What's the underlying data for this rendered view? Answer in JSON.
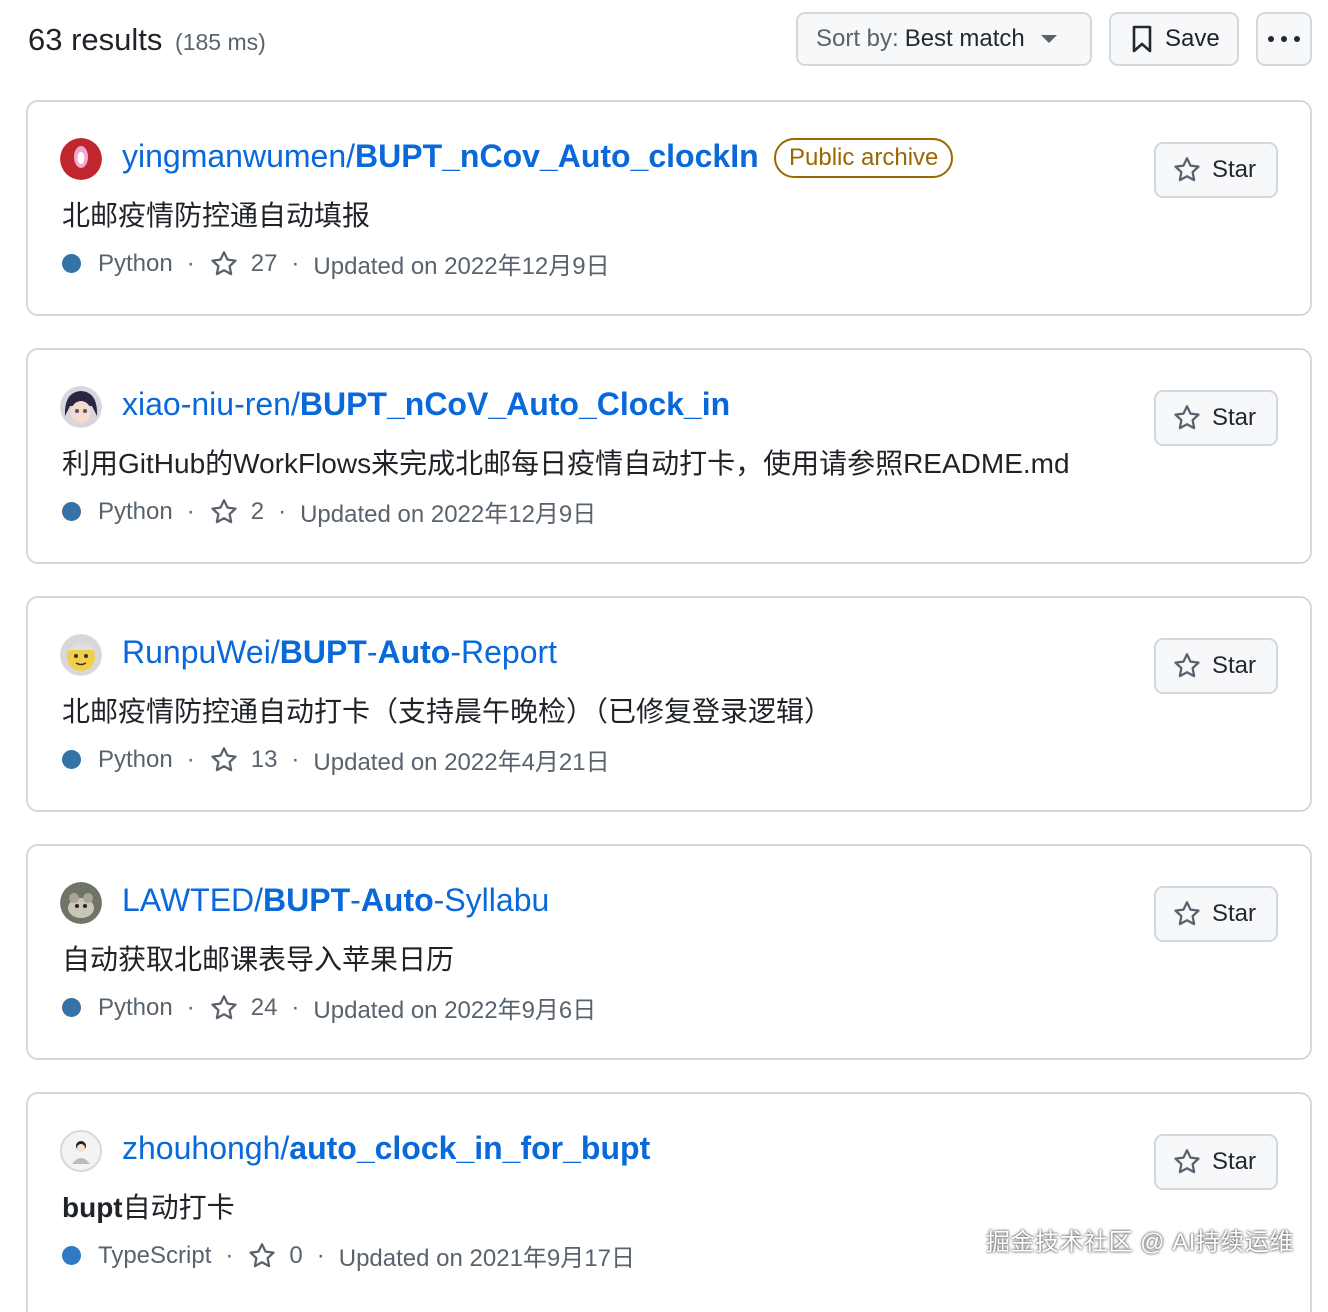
{
  "header": {
    "results_count": "63 results",
    "results_time": "(185 ms)",
    "sort_prefix": "Sort by:",
    "sort_value": "Best match",
    "save_label": "Save",
    "more_icon": "kebab-horizontal-icon"
  },
  "star_label": "Star",
  "colors": {
    "link": "#0969da",
    "archive": "#9a6700",
    "python": "#3572A5",
    "typescript": "#3178c6"
  },
  "results": [
    {
      "owner": "yingmanwumen/",
      "repo": "BUPT_nCov_Auto_clockIn",
      "badge": "Public archive",
      "description": "北邮疫情防控通自动填报",
      "language": "Python",
      "stars": "27",
      "updated": "Updated on 2022年12月9日"
    },
    {
      "owner": "xiao-niu-ren/",
      "repo": "BUPT_nCoV_Auto_Clock_in",
      "description": "利用GitHub的WorkFlows来完成北邮每日疫情自动打卡，使用请参照README.md",
      "language": "Python",
      "stars": "2",
      "updated": "Updated on 2022年12月9日"
    },
    {
      "owner": "RunpuWei/",
      "repo_parts": [
        "BUPT",
        "-",
        "Auto",
        "-Report"
      ],
      "description": "北邮疫情防控通自动打卡（支持晨午晚检）（已修复登录逻辑）",
      "language": "Python",
      "stars": "13",
      "updated": "Updated on 2022年4月21日"
    },
    {
      "owner": "LAWTED/",
      "repo_parts": [
        "BUPT",
        "-",
        "Auto",
        "-Syllabu"
      ],
      "description": "自动获取北邮课表导入苹果日历",
      "language": "Python",
      "stars": "24",
      "updated": "Updated on 2022年9月6日"
    },
    {
      "owner": "zhouhongh/",
      "repo": "auto_clock_in_for_bupt",
      "description_bold": "bupt",
      "description": "自动打卡",
      "language": "TypeScript",
      "stars": "0",
      "updated": "Updated on 2021年9月17日"
    }
  ],
  "watermark": "掘金技术社区 @ AI持续运维"
}
